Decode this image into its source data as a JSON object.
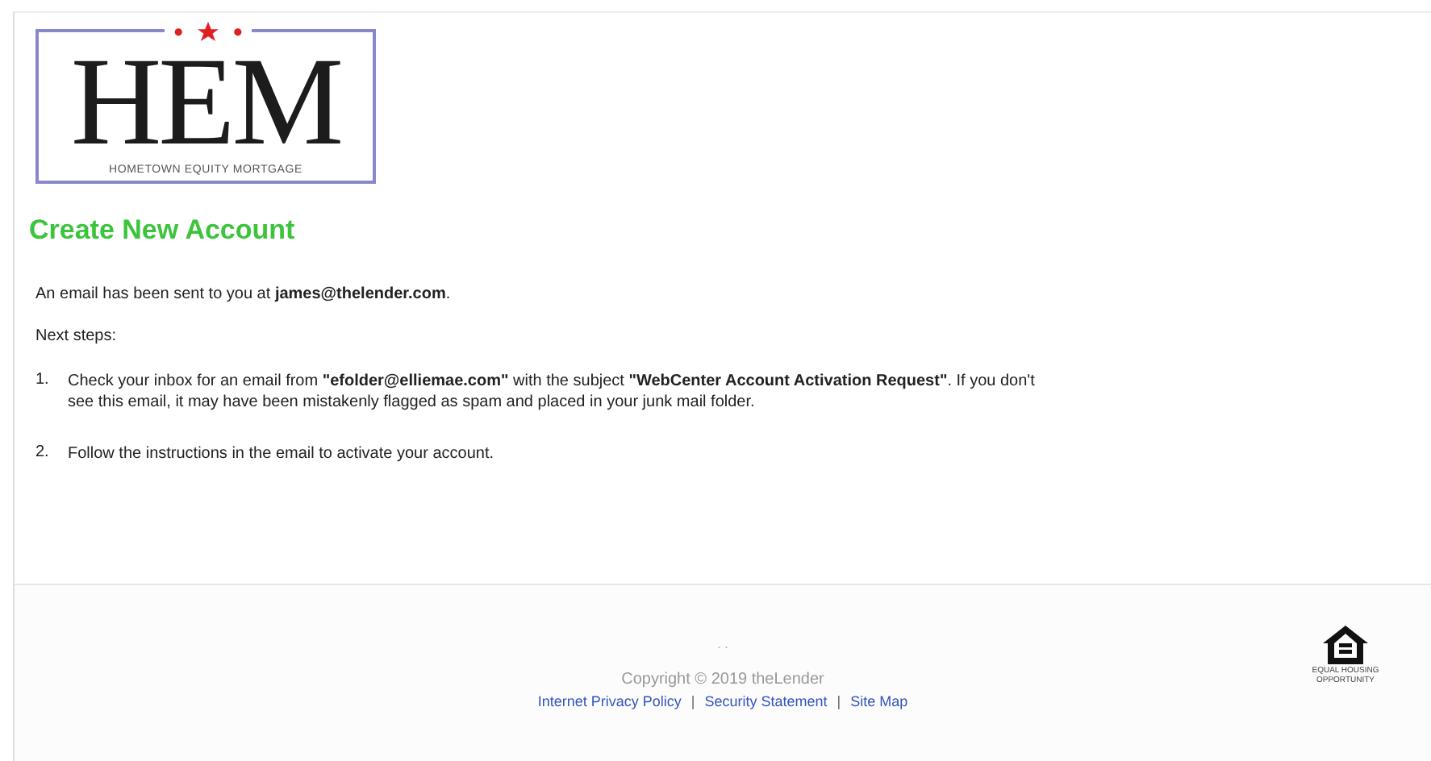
{
  "logo": {
    "mark": "HEM",
    "tagline": "HOMETOWN EQUITY MORTGAGE"
  },
  "heading": "Create New Account",
  "intro": "An email has been sent to you at **james@thelender.com**.",
  "next_label": "Next steps:",
  "steps": [
    {
      "number": "1.",
      "text": "Check your inbox for an email from **\"efolder@elliemae.com\"** with the subject **\"WebCenter Account Activation Request\"**. If you don't see this email, it may have been mistakenly flagged as spam and placed in your junk mail folder."
    },
    {
      "number": "2.",
      "text": "Follow the instructions in the email to activate your account."
    }
  ],
  "footer": {
    "dots": ". .",
    "copyright": "Copyright © 2019 theLender",
    "links": [
      {
        "label": "Internet Privacy Policy"
      },
      {
        "label": "Security Statement"
      },
      {
        "label": "Site Map"
      }
    ],
    "separator": "|",
    "badge_text": "EQUAL HOUSING OPPORTUNITY"
  }
}
